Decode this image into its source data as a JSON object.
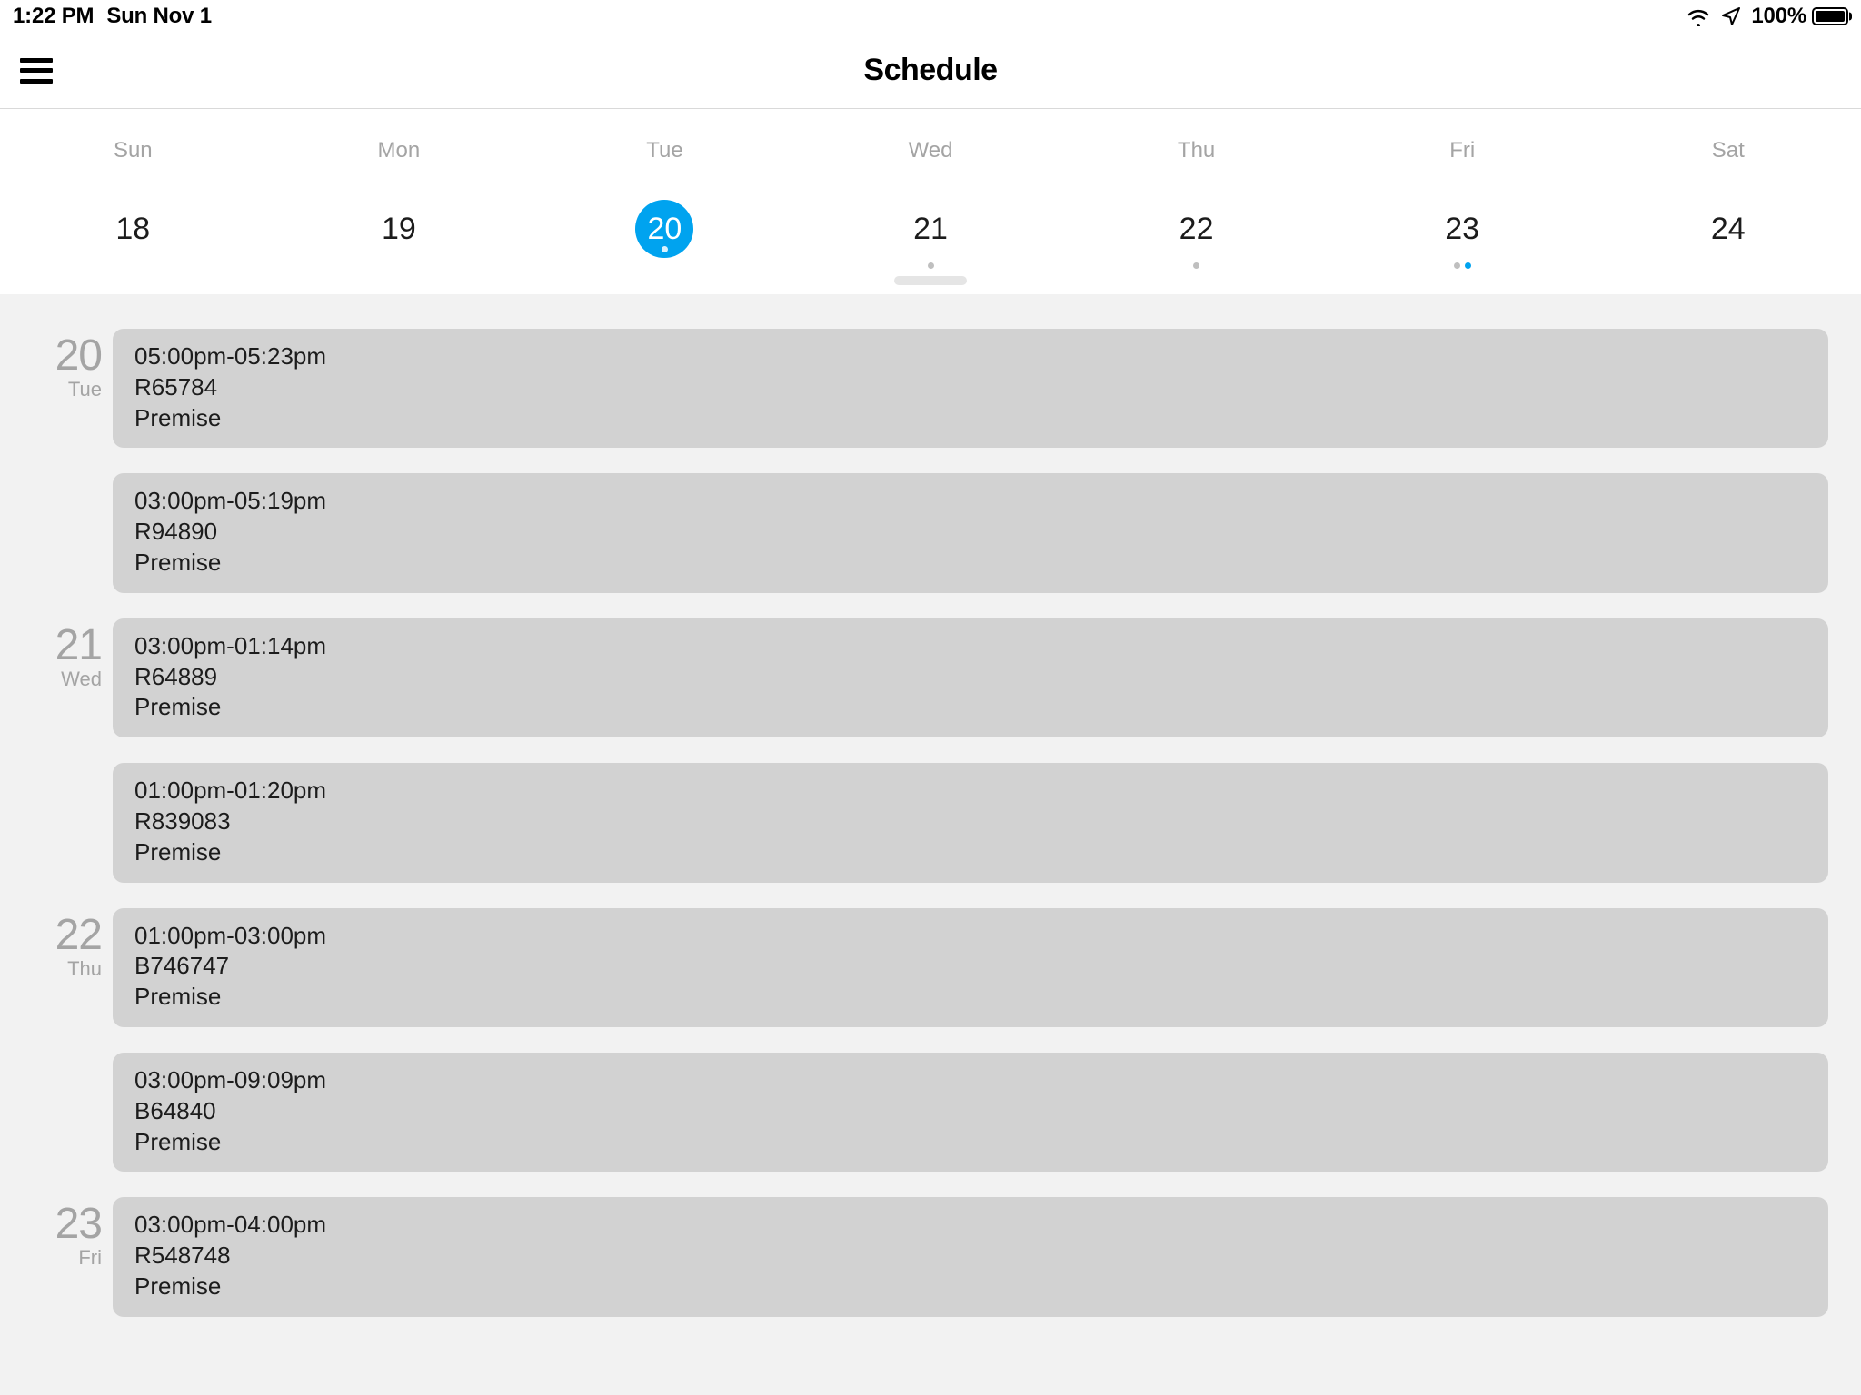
{
  "status": {
    "time": "1:22 PM",
    "date": "Sun Nov 1",
    "battery": "100%"
  },
  "header": {
    "title": "Schedule"
  },
  "week": {
    "days": [
      {
        "name": "Sun",
        "num": "18",
        "selected": false,
        "dots": 0
      },
      {
        "name": "Mon",
        "num": "19",
        "selected": false,
        "dots": 0
      },
      {
        "name": "Tue",
        "num": "20",
        "selected": true,
        "dots": 1
      },
      {
        "name": "Wed",
        "num": "21",
        "selected": false,
        "dots": 1
      },
      {
        "name": "Thu",
        "num": "22",
        "selected": false,
        "dots": 1
      },
      {
        "name": "Fri",
        "num": "23",
        "selected": false,
        "dots": 2
      },
      {
        "name": "Sat",
        "num": "24",
        "selected": false,
        "dots": 0
      }
    ]
  },
  "schedule": [
    {
      "num": "20",
      "name": "Tue",
      "events": [
        {
          "time": "05:00pm-05:23pm",
          "ref": "R65784",
          "loc": "Premise"
        },
        {
          "time": "03:00pm-05:19pm",
          "ref": "R94890",
          "loc": "Premise"
        }
      ]
    },
    {
      "num": "21",
      "name": "Wed",
      "events": [
        {
          "time": "03:00pm-01:14pm",
          "ref": "R64889",
          "loc": "Premise"
        },
        {
          "time": "01:00pm-01:20pm",
          "ref": "R839083",
          "loc": "Premise"
        }
      ]
    },
    {
      "num": "22",
      "name": "Thu",
      "events": [
        {
          "time": "01:00pm-03:00pm",
          "ref": "B746747",
          "loc": "Premise"
        },
        {
          "time": "03:00pm-09:09pm",
          "ref": "B64840",
          "loc": "Premise"
        }
      ]
    },
    {
      "num": "23",
      "name": "Fri",
      "events": [
        {
          "time": "03:00pm-04:00pm",
          "ref": "R548748",
          "loc": "Premise"
        }
      ]
    }
  ]
}
